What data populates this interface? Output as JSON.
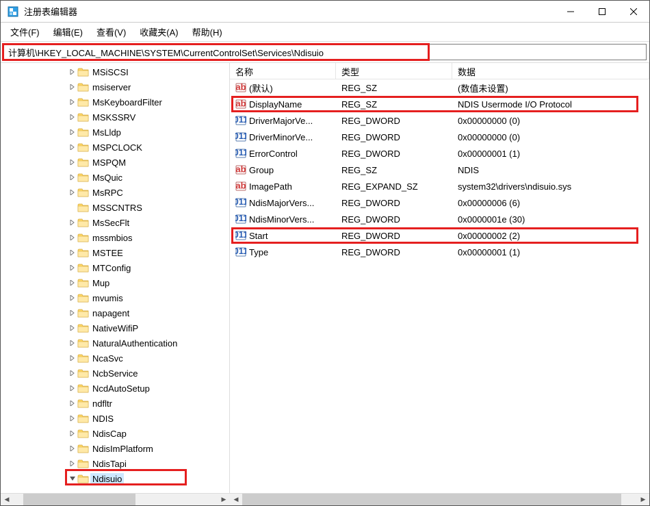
{
  "window": {
    "title": "注册表编辑器"
  },
  "menu": {
    "file": "文件(F)",
    "edit": "编辑(E)",
    "view": "查看(V)",
    "favorites": "收藏夹(A)",
    "help": "帮助(H)"
  },
  "addressbar": {
    "path": "计算机\\HKEY_LOCAL_MACHINE\\SYSTEM\\CurrentControlSet\\Services\\Ndisuio"
  },
  "tree": [
    {
      "label": "MSiSCSI",
      "exp": ">"
    },
    {
      "label": "msiserver",
      "exp": ">"
    },
    {
      "label": "MsKeyboardFilter",
      "exp": ">"
    },
    {
      "label": "MSKSSRV",
      "exp": ">"
    },
    {
      "label": "MsLldp",
      "exp": ">"
    },
    {
      "label": "MSPCLOCK",
      "exp": ">"
    },
    {
      "label": "MSPQM",
      "exp": ">"
    },
    {
      "label": "MsQuic",
      "exp": ">"
    },
    {
      "label": "MsRPC",
      "exp": ">"
    },
    {
      "label": "MSSCNTRS",
      "exp": ""
    },
    {
      "label": "MsSecFlt",
      "exp": ">"
    },
    {
      "label": "mssmbios",
      "exp": ">"
    },
    {
      "label": "MSTEE",
      "exp": ">"
    },
    {
      "label": "MTConfig",
      "exp": ">"
    },
    {
      "label": "Mup",
      "exp": ">"
    },
    {
      "label": "mvumis",
      "exp": ">"
    },
    {
      "label": "napagent",
      "exp": ">"
    },
    {
      "label": "NativeWifiP",
      "exp": ">"
    },
    {
      "label": "NaturalAuthentication",
      "exp": ">"
    },
    {
      "label": "NcaSvc",
      "exp": ">"
    },
    {
      "label": "NcbService",
      "exp": ">"
    },
    {
      "label": "NcdAutoSetup",
      "exp": ">"
    },
    {
      "label": "ndfltr",
      "exp": ">"
    },
    {
      "label": "NDIS",
      "exp": ">"
    },
    {
      "label": "NdisCap",
      "exp": ">"
    },
    {
      "label": "NdisImPlatform",
      "exp": ">"
    },
    {
      "label": "NdisTapi",
      "exp": ">"
    },
    {
      "label": "Ndisuio",
      "exp": "v",
      "selected": true
    }
  ],
  "list": {
    "headers": {
      "name": "名称",
      "type": "类型",
      "data": "数据"
    },
    "rows": [
      {
        "icon": "sz",
        "name": "(默认)",
        "type": "REG_SZ",
        "data": "(数值未设置)"
      },
      {
        "icon": "sz",
        "name": "DisplayName",
        "type": "REG_SZ",
        "data": "NDIS Usermode I/O Protocol"
      },
      {
        "icon": "dw",
        "name": "DriverMajorVe...",
        "type": "REG_DWORD",
        "data": "0x00000000 (0)"
      },
      {
        "icon": "dw",
        "name": "DriverMinorVe...",
        "type": "REG_DWORD",
        "data": "0x00000000 (0)"
      },
      {
        "icon": "dw",
        "name": "ErrorControl",
        "type": "REG_DWORD",
        "data": "0x00000001 (1)"
      },
      {
        "icon": "sz",
        "name": "Group",
        "type": "REG_SZ",
        "data": "NDIS"
      },
      {
        "icon": "sz",
        "name": "ImagePath",
        "type": "REG_EXPAND_SZ",
        "data": "system32\\drivers\\ndisuio.sys"
      },
      {
        "icon": "dw",
        "name": "NdisMajorVers...",
        "type": "REG_DWORD",
        "data": "0x00000006 (6)"
      },
      {
        "icon": "dw",
        "name": "NdisMinorVers...",
        "type": "REG_DWORD",
        "data": "0x0000001e (30)"
      },
      {
        "icon": "dw",
        "name": "Start",
        "type": "REG_DWORD",
        "data": "0x00000002 (2)"
      },
      {
        "icon": "dw",
        "name": "Type",
        "type": "REG_DWORD",
        "data": "0x00000001 (1)"
      }
    ]
  }
}
